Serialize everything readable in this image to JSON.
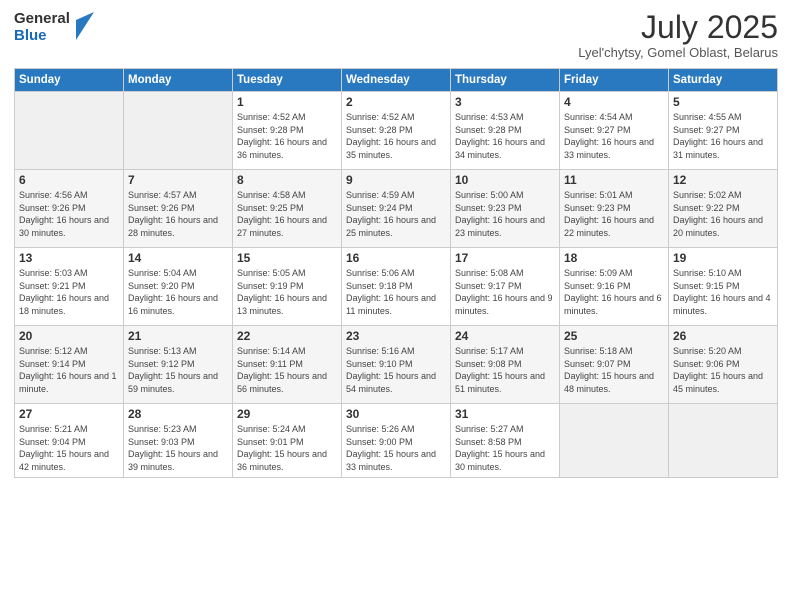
{
  "header": {
    "logo_general": "General",
    "logo_blue": "Blue",
    "title": "July 2025",
    "subtitle": "Lyel'chytsy, Gomel Oblast, Belarus"
  },
  "weekdays": [
    "Sunday",
    "Monday",
    "Tuesday",
    "Wednesday",
    "Thursday",
    "Friday",
    "Saturday"
  ],
  "weeks": [
    [
      {
        "day": "",
        "sunrise": "",
        "sunset": "",
        "daylight": ""
      },
      {
        "day": "",
        "sunrise": "",
        "sunset": "",
        "daylight": ""
      },
      {
        "day": "1",
        "sunrise": "Sunrise: 4:52 AM",
        "sunset": "Sunset: 9:28 PM",
        "daylight": "Daylight: 16 hours and 36 minutes."
      },
      {
        "day": "2",
        "sunrise": "Sunrise: 4:52 AM",
        "sunset": "Sunset: 9:28 PM",
        "daylight": "Daylight: 16 hours and 35 minutes."
      },
      {
        "day": "3",
        "sunrise": "Sunrise: 4:53 AM",
        "sunset": "Sunset: 9:28 PM",
        "daylight": "Daylight: 16 hours and 34 minutes."
      },
      {
        "day": "4",
        "sunrise": "Sunrise: 4:54 AM",
        "sunset": "Sunset: 9:27 PM",
        "daylight": "Daylight: 16 hours and 33 minutes."
      },
      {
        "day": "5",
        "sunrise": "Sunrise: 4:55 AM",
        "sunset": "Sunset: 9:27 PM",
        "daylight": "Daylight: 16 hours and 31 minutes."
      }
    ],
    [
      {
        "day": "6",
        "sunrise": "Sunrise: 4:56 AM",
        "sunset": "Sunset: 9:26 PM",
        "daylight": "Daylight: 16 hours and 30 minutes."
      },
      {
        "day": "7",
        "sunrise": "Sunrise: 4:57 AM",
        "sunset": "Sunset: 9:26 PM",
        "daylight": "Daylight: 16 hours and 28 minutes."
      },
      {
        "day": "8",
        "sunrise": "Sunrise: 4:58 AM",
        "sunset": "Sunset: 9:25 PM",
        "daylight": "Daylight: 16 hours and 27 minutes."
      },
      {
        "day": "9",
        "sunrise": "Sunrise: 4:59 AM",
        "sunset": "Sunset: 9:24 PM",
        "daylight": "Daylight: 16 hours and 25 minutes."
      },
      {
        "day": "10",
        "sunrise": "Sunrise: 5:00 AM",
        "sunset": "Sunset: 9:23 PM",
        "daylight": "Daylight: 16 hours and 23 minutes."
      },
      {
        "day": "11",
        "sunrise": "Sunrise: 5:01 AM",
        "sunset": "Sunset: 9:23 PM",
        "daylight": "Daylight: 16 hours and 22 minutes."
      },
      {
        "day": "12",
        "sunrise": "Sunrise: 5:02 AM",
        "sunset": "Sunset: 9:22 PM",
        "daylight": "Daylight: 16 hours and 20 minutes."
      }
    ],
    [
      {
        "day": "13",
        "sunrise": "Sunrise: 5:03 AM",
        "sunset": "Sunset: 9:21 PM",
        "daylight": "Daylight: 16 hours and 18 minutes."
      },
      {
        "day": "14",
        "sunrise": "Sunrise: 5:04 AM",
        "sunset": "Sunset: 9:20 PM",
        "daylight": "Daylight: 16 hours and 16 minutes."
      },
      {
        "day": "15",
        "sunrise": "Sunrise: 5:05 AM",
        "sunset": "Sunset: 9:19 PM",
        "daylight": "Daylight: 16 hours and 13 minutes."
      },
      {
        "day": "16",
        "sunrise": "Sunrise: 5:06 AM",
        "sunset": "Sunset: 9:18 PM",
        "daylight": "Daylight: 16 hours and 11 minutes."
      },
      {
        "day": "17",
        "sunrise": "Sunrise: 5:08 AM",
        "sunset": "Sunset: 9:17 PM",
        "daylight": "Daylight: 16 hours and 9 minutes."
      },
      {
        "day": "18",
        "sunrise": "Sunrise: 5:09 AM",
        "sunset": "Sunset: 9:16 PM",
        "daylight": "Daylight: 16 hours and 6 minutes."
      },
      {
        "day": "19",
        "sunrise": "Sunrise: 5:10 AM",
        "sunset": "Sunset: 9:15 PM",
        "daylight": "Daylight: 16 hours and 4 minutes."
      }
    ],
    [
      {
        "day": "20",
        "sunrise": "Sunrise: 5:12 AM",
        "sunset": "Sunset: 9:14 PM",
        "daylight": "Daylight: 16 hours and 1 minute."
      },
      {
        "day": "21",
        "sunrise": "Sunrise: 5:13 AM",
        "sunset": "Sunset: 9:12 PM",
        "daylight": "Daylight: 15 hours and 59 minutes."
      },
      {
        "day": "22",
        "sunrise": "Sunrise: 5:14 AM",
        "sunset": "Sunset: 9:11 PM",
        "daylight": "Daylight: 15 hours and 56 minutes."
      },
      {
        "day": "23",
        "sunrise": "Sunrise: 5:16 AM",
        "sunset": "Sunset: 9:10 PM",
        "daylight": "Daylight: 15 hours and 54 minutes."
      },
      {
        "day": "24",
        "sunrise": "Sunrise: 5:17 AM",
        "sunset": "Sunset: 9:08 PM",
        "daylight": "Daylight: 15 hours and 51 minutes."
      },
      {
        "day": "25",
        "sunrise": "Sunrise: 5:18 AM",
        "sunset": "Sunset: 9:07 PM",
        "daylight": "Daylight: 15 hours and 48 minutes."
      },
      {
        "day": "26",
        "sunrise": "Sunrise: 5:20 AM",
        "sunset": "Sunset: 9:06 PM",
        "daylight": "Daylight: 15 hours and 45 minutes."
      }
    ],
    [
      {
        "day": "27",
        "sunrise": "Sunrise: 5:21 AM",
        "sunset": "Sunset: 9:04 PM",
        "daylight": "Daylight: 15 hours and 42 minutes."
      },
      {
        "day": "28",
        "sunrise": "Sunrise: 5:23 AM",
        "sunset": "Sunset: 9:03 PM",
        "daylight": "Daylight: 15 hours and 39 minutes."
      },
      {
        "day": "29",
        "sunrise": "Sunrise: 5:24 AM",
        "sunset": "Sunset: 9:01 PM",
        "daylight": "Daylight: 15 hours and 36 minutes."
      },
      {
        "day": "30",
        "sunrise": "Sunrise: 5:26 AM",
        "sunset": "Sunset: 9:00 PM",
        "daylight": "Daylight: 15 hours and 33 minutes."
      },
      {
        "day": "31",
        "sunrise": "Sunrise: 5:27 AM",
        "sunset": "Sunset: 8:58 PM",
        "daylight": "Daylight: 15 hours and 30 minutes."
      },
      {
        "day": "",
        "sunrise": "",
        "sunset": "",
        "daylight": ""
      },
      {
        "day": "",
        "sunrise": "",
        "sunset": "",
        "daylight": ""
      }
    ]
  ]
}
